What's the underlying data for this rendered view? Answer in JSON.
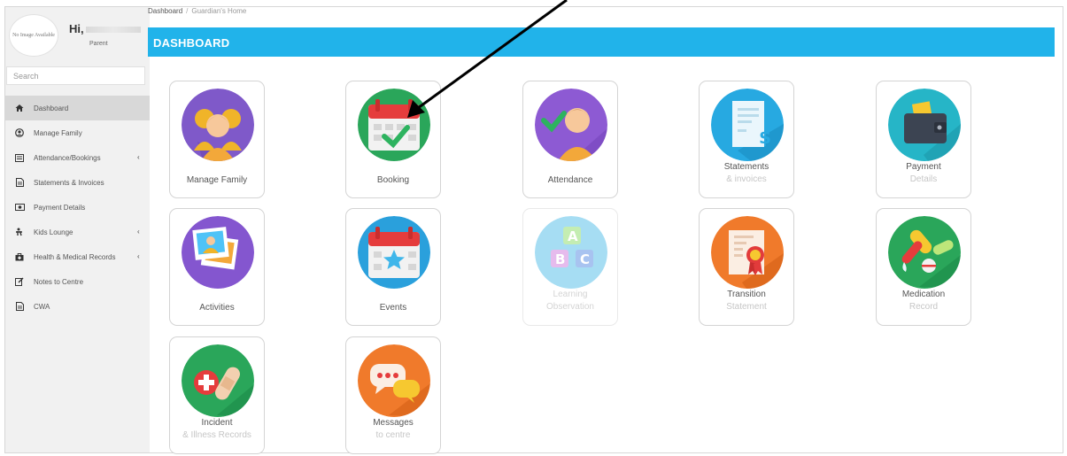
{
  "profile": {
    "avatar_text": "No Image Available",
    "greeting": "Hi,",
    "role": "Parent"
  },
  "search": {
    "placeholder": "Search"
  },
  "sidebar": {
    "items": [
      {
        "label": "Dashboard",
        "icon": "home-icon",
        "active": true,
        "caret": ""
      },
      {
        "label": "Manage Family",
        "icon": "user-icon",
        "caret": ""
      },
      {
        "label": "Attendance/Bookings",
        "icon": "list-icon",
        "caret": "‹"
      },
      {
        "label": "Statements & Invoices",
        "icon": "document-icon",
        "caret": ""
      },
      {
        "label": "Payment Details",
        "icon": "money-icon",
        "caret": ""
      },
      {
        "label": "Kids Lounge",
        "icon": "child-icon",
        "caret": "‹"
      },
      {
        "label": "Health & Medical Records",
        "icon": "briefcase-icon",
        "caret": "‹"
      },
      {
        "label": "Notes to Centre",
        "icon": "edit-icon",
        "caret": ""
      },
      {
        "label": "CWA",
        "icon": "document-icon",
        "caret": ""
      }
    ]
  },
  "breadcrumb": {
    "root": "Dashboard",
    "separator": "/",
    "current": "Guardian's Home"
  },
  "header": {
    "title": "DASHBOARD"
  },
  "tiles": [
    {
      "line1": "Manage Family",
      "line2": "",
      "icon": "family-icon"
    },
    {
      "line1": "Booking",
      "line2": "",
      "icon": "calendar-check-icon"
    },
    {
      "line1": "Attendance",
      "line2": "",
      "icon": "attendance-icon"
    },
    {
      "line1": "Statements",
      "line2": "& invoices",
      "icon": "receipt-icon"
    },
    {
      "line1": "Payment",
      "line2": "Details",
      "icon": "wallet-icon"
    },
    {
      "line1": "Activities",
      "line2": "",
      "icon": "photos-icon"
    },
    {
      "line1": "Events",
      "line2": "",
      "icon": "calendar-star-icon"
    },
    {
      "line1": "Learning",
      "line2": "Observation",
      "icon": "abc-blocks-icon"
    },
    {
      "line1": "Transition",
      "line2": "Statement",
      "icon": "certificate-icon"
    },
    {
      "line1": "Medication",
      "line2": "Record",
      "icon": "pills-icon"
    },
    {
      "line1": "Incident",
      "line2": "& Illness Records",
      "icon": "first-aid-icon"
    },
    {
      "line1": "Messages",
      "line2": "to centre",
      "icon": "chat-bubbles-icon"
    }
  ],
  "colors": {
    "header": "#21b3ea",
    "sidebar_bg": "#f1f1f1",
    "active_item": "#d8d8d8"
  }
}
